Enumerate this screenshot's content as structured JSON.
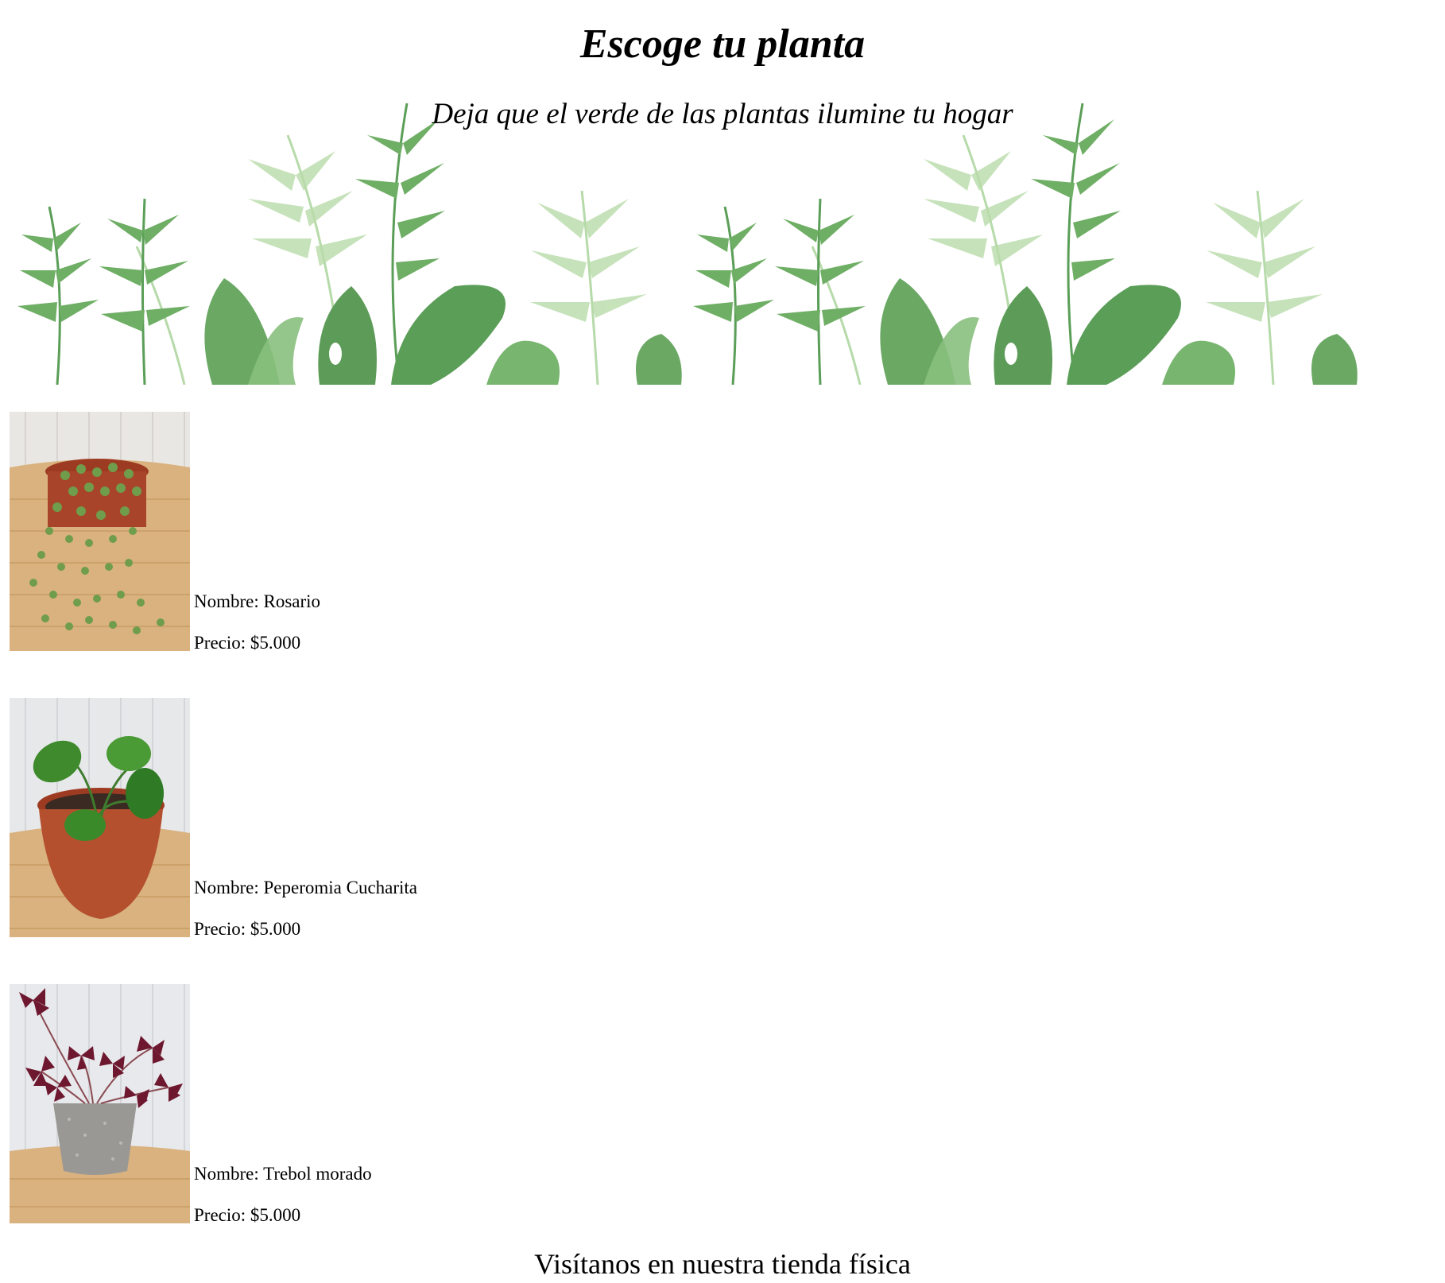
{
  "header": {
    "title": "Escoge tu planta",
    "subtitle": "Deja que el verde de las plantas ilumine tu hogar"
  },
  "banner": {
    "image": "tropical-leaves-banner"
  },
  "products": [
    {
      "name_label": "Nombre: Rosario",
      "price_label": "Precio: $5.000",
      "image": "string-of-pearls-plant-photo"
    },
    {
      "name_label": "Nombre: Peperomia Cucharita",
      "price_label": "Precio: $5.000",
      "image": "peperomia-plant-photo"
    },
    {
      "name_label": "Nombre: Trebol morado",
      "price_label": "Precio: $5.000",
      "image": "purple-shamrock-plant-photo"
    }
  ],
  "footer": {
    "heading": "Visítanos en nuestra tienda física"
  },
  "colors": {
    "leaf_dark": "#5a9e57",
    "leaf_light": "#a9d39a",
    "pot_terracotta": "#b5502f",
    "wicker": "#d9b27f",
    "shamrock_purple": "#6e1830"
  }
}
